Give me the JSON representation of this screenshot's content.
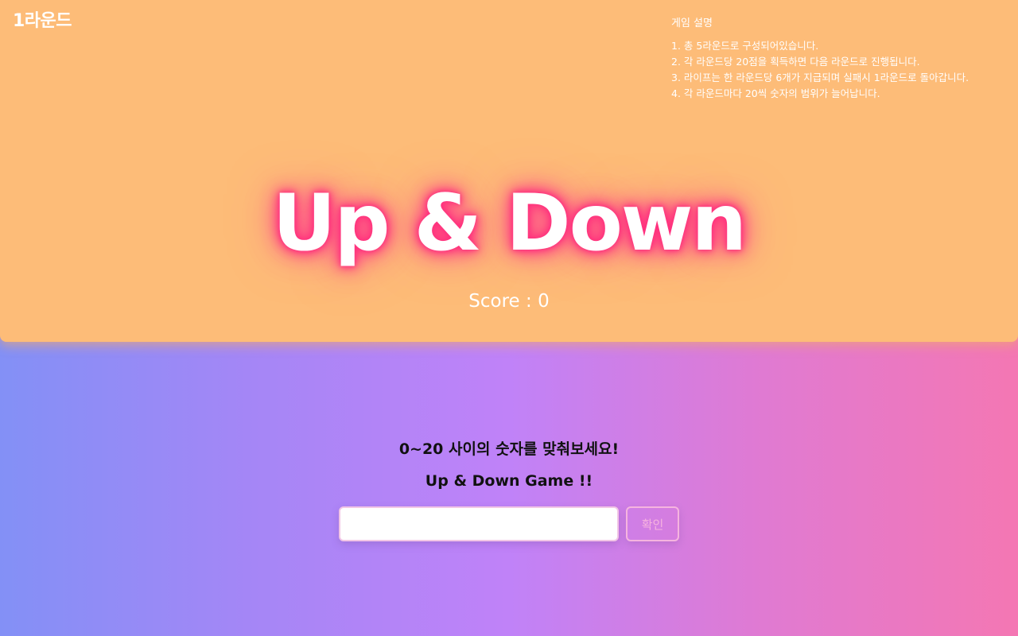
{
  "header": {
    "round_label": "1라운드"
  },
  "rules": {
    "title": "게임 설명",
    "items": [
      "1. 총 5라운드로 구성되어있습니다.",
      "2. 각 라운드당 20점을 획득하면 다음 라운드로 진행됩니다.",
      "3. 라이프는 한 라운드당 6개가 지급되며 실패시 1라운드로 돌아갑니다.",
      "4. 각 라운드마다 20씩 숫자의 범위가 늘어납니다."
    ]
  },
  "game": {
    "title": "Up & Down",
    "score_text": "Score : 0",
    "prompt": "0~20 사이의 숫자를 맞춰보세요!",
    "subtitle": "Up & Down Game !!",
    "input_value": "",
    "confirm_label": "확인"
  },
  "colors": {
    "top_panel": "#fdbc78",
    "title_glow": "#ff2f7e",
    "gradient_left": "#8390f6",
    "gradient_mid": "#c082f8",
    "gradient_right": "#f477b3"
  }
}
